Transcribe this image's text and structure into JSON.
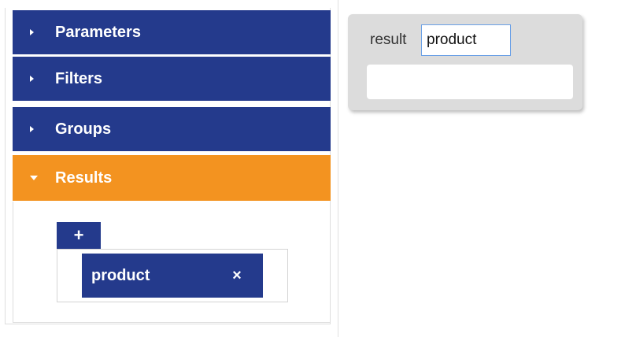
{
  "accordion": {
    "sections": [
      {
        "label": "Parameters",
        "expanded": false
      },
      {
        "label": "Filters",
        "expanded": false
      },
      {
        "label": "Groups",
        "expanded": false
      },
      {
        "label": "Results",
        "expanded": true
      }
    ]
  },
  "results": {
    "add_button_label": "+",
    "items": [
      {
        "label": "product",
        "remove_label": "×"
      }
    ]
  },
  "card": {
    "label": "result",
    "input_value": "product",
    "output_value": ""
  },
  "colors": {
    "header_collapsed": "#243a8c",
    "header_expanded": "#f39320",
    "card_background": "#dcdcdc",
    "input_focus_border": "#6aa0e6"
  },
  "icons": {
    "collapsed": "caret-right-icon",
    "expanded": "caret-down-icon",
    "remove": "close-icon",
    "add": "plus-icon"
  }
}
